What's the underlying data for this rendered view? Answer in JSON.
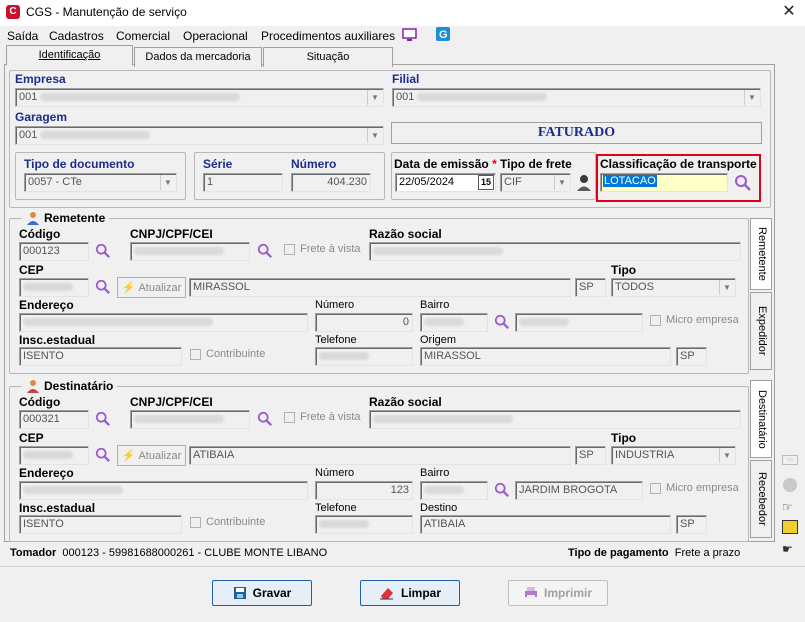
{
  "window": {
    "title": "CGS - Manutenção de serviço",
    "logo": "C",
    "close": "✕"
  },
  "menu": [
    "Saída",
    "Cadastros",
    "Comercial",
    "Operacional",
    "Procedimentos auxiliares"
  ],
  "tabs": [
    "Identificação",
    "Dados da mercadoria",
    "Situação"
  ],
  "header": {
    "empresa_label": "Empresa",
    "empresa_value": "001",
    "filial_label": "Filial",
    "filial_value": "001",
    "garagem_label": "Garagem",
    "garagem_value": "001",
    "status": "FATURADO",
    "tipo_doc_label": "Tipo de documento",
    "tipo_doc_value": "0057 - CTe",
    "serie_label": "Série",
    "serie_value": "1",
    "numero_label": "Número",
    "numero_value": "404.230",
    "data_label": "Data de emissão",
    "data_value": "22/05/2024",
    "cal_icon": "15",
    "tipo_frete_label": "Tipo de frete",
    "tipo_frete_value": "CIF",
    "classif_label": "Classificação de transporte",
    "classif_value": "LOTACAO",
    "required_mark": "*"
  },
  "remetente": {
    "title": "Remetente",
    "codigo_label": "Código",
    "codigo_value": "000123",
    "cnpj_label": "CNPJ/CPF/CEI",
    "frete_vista": "Frete à vista",
    "razao_label": "Razão social",
    "cep_label": "CEP",
    "atualizar": "Atualizar",
    "cidade": "MIRASSOL",
    "uf": "SP",
    "tipo_label": "Tipo",
    "tipo_value": "TODOS",
    "endereco_label": "Endereço",
    "numero_label": "Número",
    "numero_value": "0",
    "bairro_label": "Bairro",
    "micro": "Micro empresa",
    "insc_label": "Insc.estadual",
    "insc_value": "ISENTO",
    "contribuinte": "Contribuinte",
    "telefone_label": "Telefone",
    "origem_label": "Origem",
    "origem_value": "MIRASSOL",
    "origem_uf": "SP"
  },
  "destinatario": {
    "title": "Destinatário",
    "codigo_label": "Código",
    "codigo_value": "000321",
    "cnpj_label": "CNPJ/CPF/CEI",
    "frete_vista": "Frete à vista",
    "razao_label": "Razão social",
    "cep_label": "CEP",
    "atualizar": "Atualizar",
    "cidade": "ATIBAIA",
    "uf": "SP",
    "tipo_label": "Tipo",
    "tipo_value": "INDUSTRIA",
    "endereco_label": "Endereço",
    "numero_label": "Número",
    "numero_value": "123",
    "bairro_label": "Bairro",
    "bairro_value": "JARDIM BROGOTA",
    "micro": "Micro empresa",
    "insc_label": "Insc.estadual",
    "insc_value": "ISENTO",
    "contribuinte": "Contribuinte",
    "telefone_label": "Telefone",
    "destino_label": "Destino",
    "destino_value": "ATIBAIA",
    "destino_uf": "SP"
  },
  "side_tabs": [
    "Remetente",
    "Expedidor",
    "Destinatário",
    "Recebedor"
  ],
  "footer": {
    "tomador_label": "Tomador",
    "tomador_value": "000123 - 59981688000261 - CLUBE MONTE LIBANO",
    "pagamento_label": "Tipo de pagamento",
    "pagamento_value": "Frete a prazo"
  },
  "buttons": {
    "gravar": "Gravar",
    "limpar": "Limpar",
    "imprimir": "Imprimir"
  },
  "colors": {
    "accent": "#1c2c8c",
    "highlight_border": "#e0001a",
    "selection": "#0078d7",
    "field_yellow": "#ffffc8",
    "lens": "#9b59d0"
  }
}
